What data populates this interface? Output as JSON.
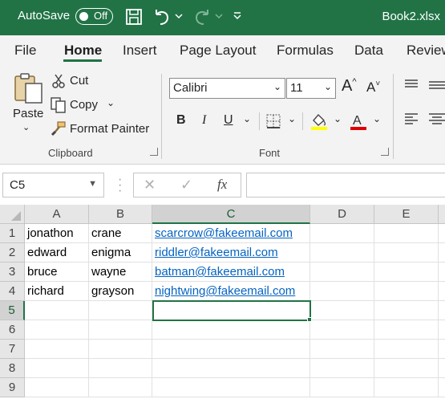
{
  "titlebar": {
    "autosave_label": "AutoSave",
    "autosave_state": "Off",
    "filename": "Book2.xlsx",
    "icons": [
      "save-icon",
      "undo-icon",
      "redo-icon",
      "customize-qat-icon"
    ]
  },
  "tabs": [
    "File",
    "Home",
    "Insert",
    "Page Layout",
    "Formulas",
    "Data",
    "Review"
  ],
  "active_tab": "Home",
  "clipboard": {
    "paste": "Paste",
    "cut": "Cut",
    "copy": "Copy",
    "format_painter": "Format Painter",
    "group_label": "Clipboard"
  },
  "font": {
    "font_name": "Calibri",
    "font_size": "11",
    "group_label": "Font",
    "bold": "B",
    "italic": "I",
    "underline": "U"
  },
  "formula_bar": {
    "name_box": "C5",
    "cancel": "✕",
    "enter": "✓",
    "fx": "fx",
    "value": ""
  },
  "grid": {
    "columns": [
      "A",
      "B",
      "C",
      "D",
      "E"
    ],
    "rows": [
      "1",
      "2",
      "3",
      "4",
      "5",
      "6",
      "7",
      "8",
      "9"
    ],
    "data": [
      [
        "jonathon",
        "crane",
        "scarcrow@fakeemail.com"
      ],
      [
        "edward",
        "enigma",
        "riddler@fakeemail.com"
      ],
      [
        "bruce",
        "wayne",
        "batman@fakeemail.com"
      ],
      [
        "richard",
        "grayson",
        "nightwing@fakeemail.com"
      ]
    ],
    "selected_cell": "C5"
  },
  "colors": {
    "brand": "#217346",
    "hyperlink": "#0563c1",
    "highlight": "#ffff00",
    "font_color": "#e00000"
  }
}
